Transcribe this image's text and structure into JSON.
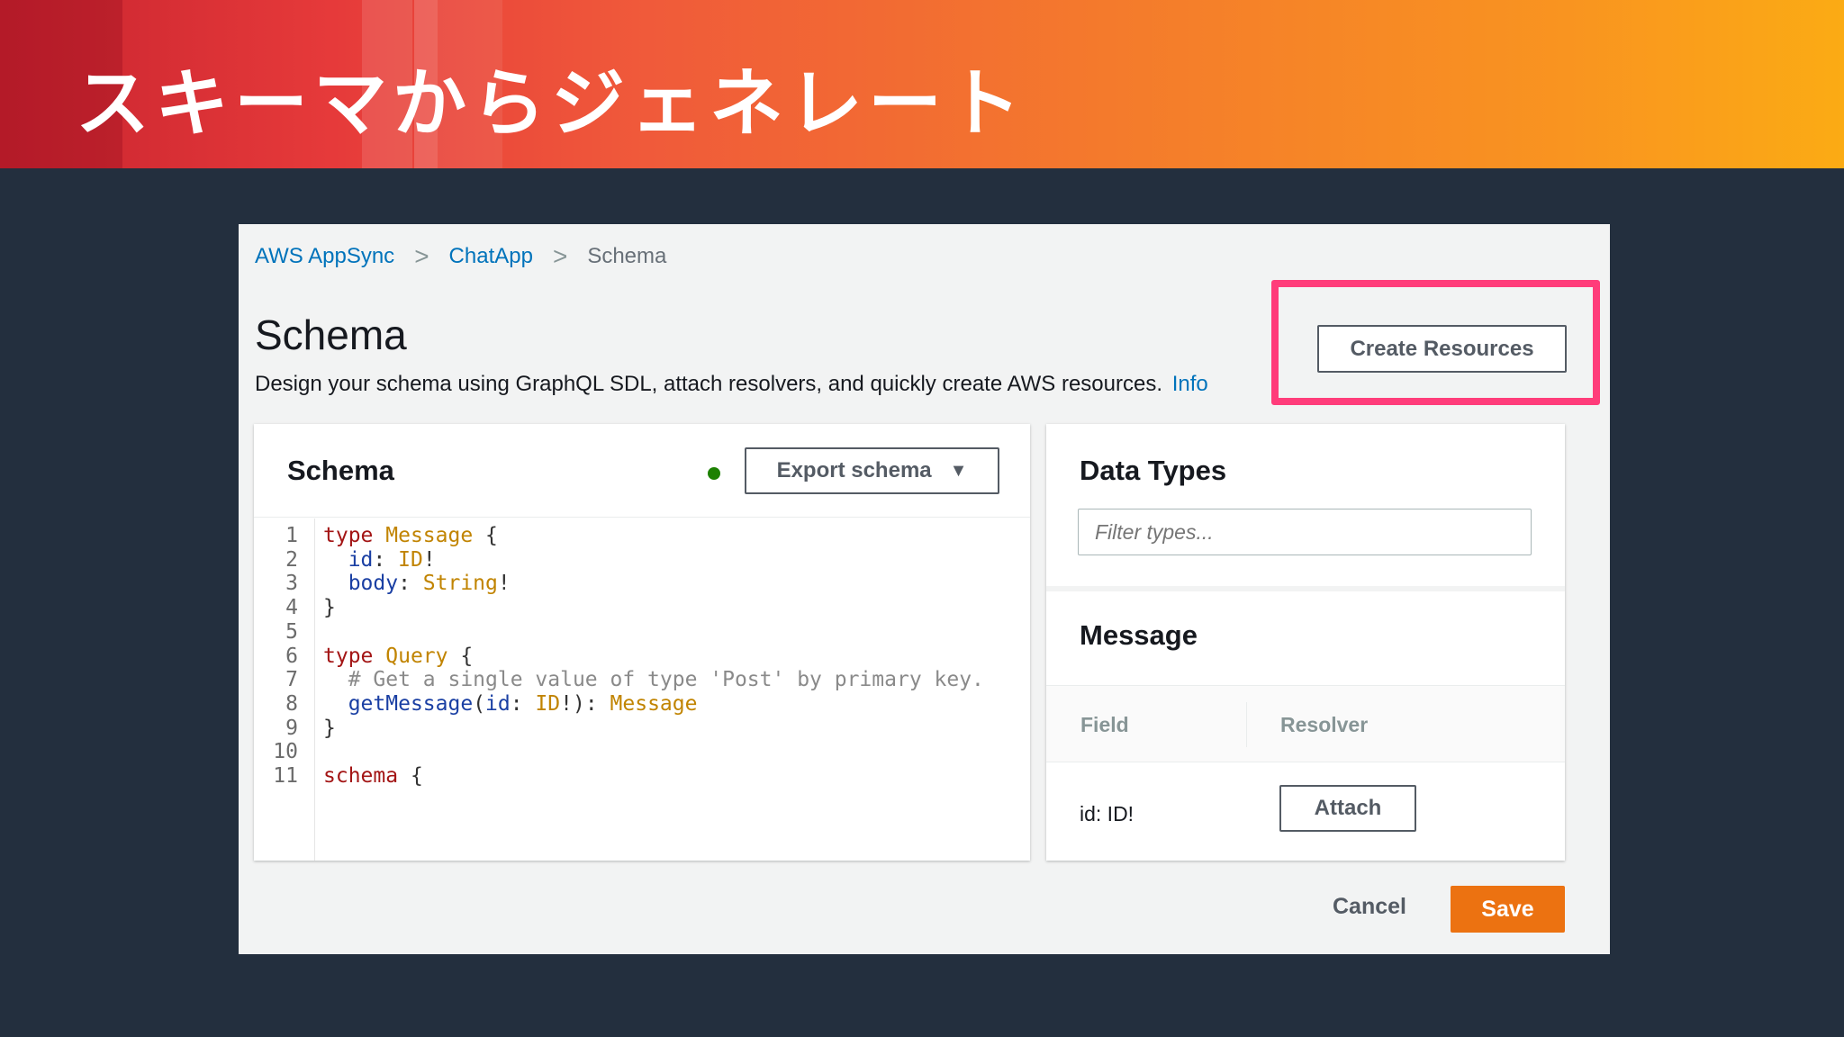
{
  "banner": {
    "title": "スキーマからジェネレート"
  },
  "breadcrumb": {
    "items": [
      "AWS AppSync",
      "ChatApp"
    ],
    "current": "Schema",
    "separator": ">"
  },
  "page": {
    "title": "Schema",
    "description": "Design your schema using GraphQL SDL, attach resolvers, and quickly create AWS resources.",
    "info_link": "Info"
  },
  "actions": {
    "create_resources": "Create Resources"
  },
  "schema_panel": {
    "title": "Schema",
    "export_label": "Export schema",
    "export_caret": "▼",
    "status": "green",
    "line_numbers": [
      "1",
      "2",
      "3",
      "4",
      "5",
      "6",
      "7",
      "8",
      "9",
      "10",
      "11"
    ],
    "code": [
      [
        {
          "t": "type ",
          "c": "kw"
        },
        {
          "t": "Message",
          "c": "ty"
        },
        {
          "t": " {",
          "c": ""
        }
      ],
      [
        {
          "t": "  ",
          "c": ""
        },
        {
          "t": "id",
          "c": "fd"
        },
        {
          "t": ": ",
          "c": ""
        },
        {
          "t": "ID",
          "c": "ty"
        },
        {
          "t": "!",
          "c": ""
        }
      ],
      [
        {
          "t": "  ",
          "c": ""
        },
        {
          "t": "body",
          "c": "fd"
        },
        {
          "t": ": ",
          "c": ""
        },
        {
          "t": "String",
          "c": "ty"
        },
        {
          "t": "!",
          "c": ""
        }
      ],
      [
        {
          "t": "}",
          "c": ""
        }
      ],
      [],
      [
        {
          "t": "type ",
          "c": "kw"
        },
        {
          "t": "Query",
          "c": "ty"
        },
        {
          "t": " {",
          "c": ""
        }
      ],
      [
        {
          "t": "  # Get a single value of type 'Post' by primary key.",
          "c": "cm"
        }
      ],
      [
        {
          "t": "  ",
          "c": ""
        },
        {
          "t": "getMessage",
          "c": "fd"
        },
        {
          "t": "(",
          "c": ""
        },
        {
          "t": "id",
          "c": "fd"
        },
        {
          "t": ": ",
          "c": ""
        },
        {
          "t": "ID",
          "c": "ty"
        },
        {
          "t": "!): ",
          "c": ""
        },
        {
          "t": "Message",
          "c": "ty"
        }
      ],
      [
        {
          "t": "}",
          "c": ""
        }
      ],
      [],
      [
        {
          "t": "schema",
          "c": "kw"
        },
        {
          "t": " {",
          "c": ""
        }
      ]
    ]
  },
  "data_types": {
    "title": "Data Types",
    "filter_placeholder": "Filter types...",
    "type_name": "Message",
    "columns": [
      "Field",
      "Resolver"
    ],
    "rows": [
      {
        "field": "id: ID!",
        "action": "Attach"
      }
    ]
  },
  "footer": {
    "cancel": "Cancel",
    "save": "Save"
  },
  "colors": {
    "accent": "#ec7211",
    "link": "#0073bb",
    "highlight": "#ff3c7a",
    "status_ok": "#1d8102"
  }
}
